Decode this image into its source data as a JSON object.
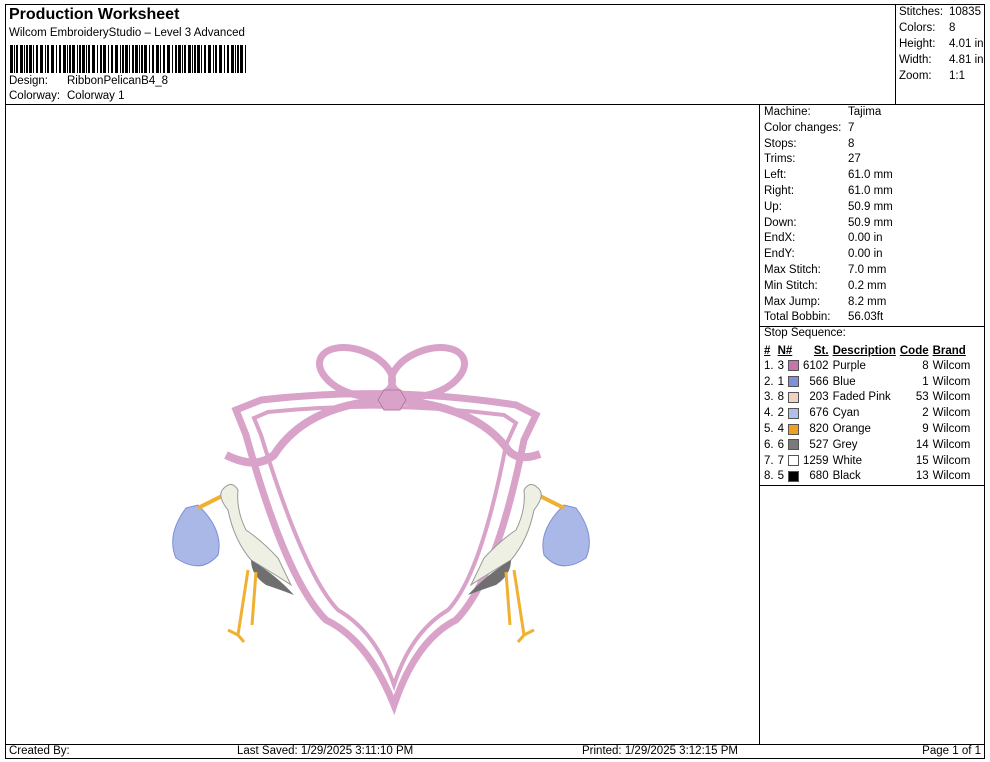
{
  "header": {
    "title": "Production Worksheet",
    "subtitle": "Wilcom EmbroideryStudio – Level 3 Advanced",
    "design_label": "Design:",
    "design_value": "RibbonPelicanB4_8",
    "colorway_label": "Colorway:",
    "colorway_value": "Colorway 1"
  },
  "summary": [
    {
      "label": "Stitches:",
      "value": "10835"
    },
    {
      "label": "Colors:",
      "value": "8"
    },
    {
      "label": "Height:",
      "value": "4.01 in"
    },
    {
      "label": "Width:",
      "value": "4.81 in"
    },
    {
      "label": "Zoom:",
      "value": "1:1"
    }
  ],
  "properties": [
    {
      "label": "Machine:",
      "value": "Tajima"
    },
    {
      "label": "Color changes:",
      "value": "7"
    },
    {
      "label": "Stops:",
      "value": "8"
    },
    {
      "label": "Trims:",
      "value": "27"
    },
    {
      "label": "Left:",
      "value": "61.0 mm"
    },
    {
      "label": "Right:",
      "value": "61.0 mm"
    },
    {
      "label": "Up:",
      "value": "50.9 mm"
    },
    {
      "label": "Down:",
      "value": "50.9 mm"
    },
    {
      "label": "EndX:",
      "value": "0.00 in"
    },
    {
      "label": "EndY:",
      "value": "0.00 in"
    },
    {
      "label": "Max Stitch:",
      "value": "7.0 mm"
    },
    {
      "label": "Min Stitch:",
      "value": "0.2 mm"
    },
    {
      "label": "Max Jump:",
      "value": "8.2 mm"
    },
    {
      "label": "Total Bobbin:",
      "value": "56.03ft"
    }
  ],
  "stop_sequence": {
    "title": "Stop Sequence:",
    "headers": [
      "#",
      "N#",
      "St.",
      "Description",
      "Code",
      "Brand"
    ],
    "rows": [
      {
        "num": "1.",
        "n": "3",
        "color": "#c873b0",
        "st": "6102",
        "desc": "Purple",
        "code": "8",
        "brand": "Wilcom"
      },
      {
        "num": "2.",
        "n": "1",
        "color": "#7f8fd8",
        "st": "566",
        "desc": "Blue",
        "code": "1",
        "brand": "Wilcom"
      },
      {
        "num": "3.",
        "n": "8",
        "color": "#f0d2c0",
        "st": "203",
        "desc": "Faded Pink",
        "code": "53",
        "brand": "Wilcom"
      },
      {
        "num": "4.",
        "n": "2",
        "color": "#b2bfe8",
        "st": "676",
        "desc": "Cyan",
        "code": "2",
        "brand": "Wilcom"
      },
      {
        "num": "5.",
        "n": "4",
        "color": "#f0a01e",
        "st": "820",
        "desc": "Orange",
        "code": "9",
        "brand": "Wilcom"
      },
      {
        "num": "6.",
        "n": "6",
        "color": "#7a7a7a",
        "st": "527",
        "desc": "Grey",
        "code": "14",
        "brand": "Wilcom"
      },
      {
        "num": "7.",
        "n": "7",
        "color": "#ffffff",
        "st": "1259",
        "desc": "White",
        "code": "15",
        "brand": "Wilcom"
      },
      {
        "num": "8.",
        "n": "5",
        "color": "#000000",
        "st": "680",
        "desc": "Black",
        "code": "13",
        "brand": "Wilcom"
      }
    ]
  },
  "footer": {
    "created_by": "Created By:",
    "last_saved": "Last Saved: 1/29/2025 3:11:10 PM",
    "printed": "Printed: 1/29/2025 3:12:15 PM",
    "page": "Page 1 of 1"
  },
  "design_colors": {
    "ribbon": "#d9a2c9",
    "ribbon_dark": "#b77aa6",
    "bundle": "#a9b8e6",
    "beak": "#f0b030",
    "body": "#eef0e4",
    "wing": "#6f6f6f"
  }
}
